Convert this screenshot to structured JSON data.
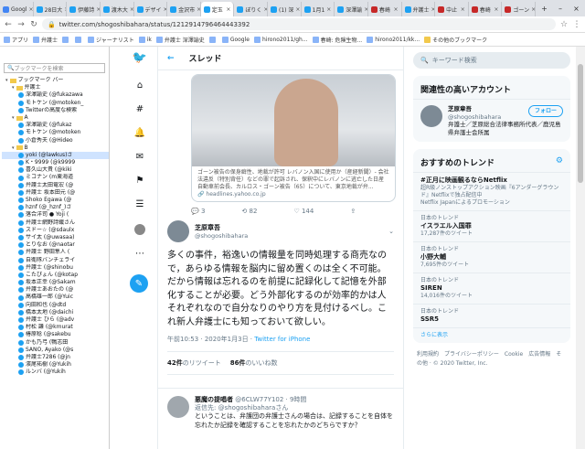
{
  "tabs": [
    {
      "label": "Googl",
      "color": "#4285f4"
    },
    {
      "label": "28日大",
      "color": "#1da1f2"
    },
    {
      "label": "伊藤詩",
      "color": "#1da1f2"
    },
    {
      "label": "渡木大",
      "color": "#1da1f2"
    },
    {
      "label": "デザイ",
      "color": "#1da1f2"
    },
    {
      "label": "金沢市",
      "color": "#1da1f2"
    },
    {
      "label": "定玉",
      "color": "#1da1f2",
      "active": true
    },
    {
      "label": "ぼりく",
      "color": "#1da1f2"
    },
    {
      "label": "(1) 深",
      "color": "#1da1f2"
    },
    {
      "label": "1月1",
      "color": "#1da1f2"
    },
    {
      "label": "深澤諭",
      "color": "#1da1f2"
    },
    {
      "label": "春崎",
      "color": "#c62828"
    },
    {
      "label": "弁護士",
      "color": "#1da1f2"
    },
    {
      "label": "中止",
      "color": "#c62828"
    },
    {
      "label": "春崎",
      "color": "#c62828"
    },
    {
      "label": "ゴーン",
      "color": "#c62828"
    }
  ],
  "address": {
    "url": "twitter.com/shogoshibahara/status/1212914796464443392"
  },
  "bookmarks": [
    {
      "label": "アプリ",
      "folder": false
    },
    {
      "label": "弁護士",
      "folder": false
    },
    {
      "label": "",
      "folder": false
    },
    {
      "label": "",
      "folder": false
    },
    {
      "label": "ジャーナリスト",
      "folder": false
    },
    {
      "label": "ik",
      "folder": false
    },
    {
      "label": "弁護士 深澤諭史",
      "folder": false
    },
    {
      "label": "",
      "folder": false
    },
    {
      "label": "Google",
      "folder": false
    },
    {
      "label": "hirono2011/gh...",
      "folder": false
    },
    {
      "label": "春崎: 危険生物...",
      "folder": false
    },
    {
      "label": "hirono2011/kk...",
      "folder": false
    },
    {
      "label": "その他のブックマーク",
      "folder": true
    }
  ],
  "sidebar": {
    "search_placeholder": "ブックマークを検索",
    "items": [
      {
        "label": "ブックマーク バー",
        "type": "folder",
        "level": 0
      },
      {
        "label": "弁護士",
        "type": "folder",
        "level": 1
      },
      {
        "label": "深澤諭史 (@fukazawa",
        "type": "bird",
        "level": 2
      },
      {
        "label": "モトケン (@motoken_",
        "type": "bird",
        "level": 2
      },
      {
        "label": "Twitterの高度な検索",
        "type": "bird",
        "level": 2
      },
      {
        "label": "A",
        "type": "folder",
        "level": 1
      },
      {
        "label": "深澤諭史 (@fukaz",
        "type": "bird",
        "level": 2
      },
      {
        "label": "モトケン (@motoken",
        "type": "bird",
        "level": 2
      },
      {
        "label": "小倉秀夫 (@Hideo",
        "type": "bird",
        "level": 2
      },
      {
        "label": "B",
        "type": "folder",
        "level": 1
      },
      {
        "label": "yoki (@lawkus)さ",
        "type": "bird",
        "level": 2,
        "hl": true
      },
      {
        "label": "K・9999 (@k9999",
        "type": "bird",
        "level": 2
      },
      {
        "label": "喜久山大貴 (@kiki",
        "type": "bird",
        "level": 2
      },
      {
        "label": "ミコナン (m東海道",
        "type": "bird",
        "level": 2
      },
      {
        "label": "弁護士太田竜宏 (@",
        "type": "bird",
        "level": 2
      },
      {
        "label": "弁護士 坂本田元 (@",
        "type": "bird",
        "level": 2
      },
      {
        "label": "Shoko Egawa (@",
        "type": "bird",
        "level": 2
      },
      {
        "label": "hznf (@_hznf_)さ",
        "type": "bird",
        "level": 2
      },
      {
        "label": "落合洋司 ● Yoji (",
        "type": "bird",
        "level": 2
      },
      {
        "label": "弁護士網野詩織さん",
        "type": "bird",
        "level": 2
      },
      {
        "label": "スドー☆ (@sdaulx",
        "type": "bird",
        "level": 2
      },
      {
        "label": "サイ太 (@uwasaa)",
        "type": "bird",
        "level": 2
      },
      {
        "label": "とりなお (@naotar",
        "type": "bird",
        "level": 2
      },
      {
        "label": "弁護士 野田隼人 (",
        "type": "bird",
        "level": 2
      },
      {
        "label": "自衛隊バンチェライ",
        "type": "bird",
        "level": 2
      },
      {
        "label": "弁護士 (@shinobu",
        "type": "bird",
        "level": 2
      },
      {
        "label": "こたぴょん (@kotap",
        "type": "bird",
        "level": 2
      },
      {
        "label": "坂本正幸 (@Sakam",
        "type": "bird",
        "level": 2
      },
      {
        "label": "弁護士あおたの (@",
        "type": "bird",
        "level": 2
      },
      {
        "label": "高橋雄一郎 (@Yuic",
        "type": "bird",
        "level": 2
      },
      {
        "label": "向田和也 (@dtd",
        "type": "bird",
        "level": 2
      },
      {
        "label": "橋本太地 (@daichi",
        "type": "bird",
        "level": 2
      },
      {
        "label": "弁護士 ひら (@adv",
        "type": "bird",
        "level": 2
      },
      {
        "label": "村松 謙 (@kmurat",
        "type": "bird",
        "level": 2
      },
      {
        "label": "椿原稔 (@sakebu",
        "type": "bird",
        "level": 2
      },
      {
        "label": "かも乃弓 (鴨志田",
        "type": "bird",
        "level": 2
      },
      {
        "label": "SANO, Ayako (@s",
        "type": "bird",
        "level": 2
      },
      {
        "label": "弁護士7286 (@jn",
        "type": "bird",
        "level": 2
      },
      {
        "label": "濱尾祐樹 (@Yukih",
        "type": "bird",
        "level": 2
      },
      {
        "label": "ルンバ (@Yukih",
        "type": "bird",
        "level": 2
      }
    ]
  },
  "header": {
    "title": "スレッド",
    "back_icon": "arrow-left-icon"
  },
  "card": {
    "text": "ゴーン被告の保身癖性、地裁が許可 レバノン入国に使用か（産経新聞）- 会社法違反（特別背任）などの罪で起訴され、保釈中にレバノンに逃亡した日産自動車前会長、カルロス・ゴーン被告（65）について、東京地裁が弁...",
    "link": "headlines.yahoo.co.jp"
  },
  "actions": {
    "replies": "3",
    "retweets": "82",
    "likes": "144"
  },
  "tweet": {
    "name": "芝原章吾",
    "handle": "@shogoshibahara",
    "body": "多くの事件，裕逸いの情報量を同時処理する商売なので，あらゆる情報を脳内に留め置くのは全く不可能。だから情報は忘れるのを前提に記録化して記憶を外部化することが必要。どう外部化するのが効率的かは人それぞれなので自分なりのやり方を見付けるべし。これ新人弁護士にも知っておいて欲しい。",
    "time": "午前10:53 · 2020年1月3日 · ",
    "client": "Twitter for iPhone",
    "retweets": "42件",
    "retweets_label": "のリツイート",
    "likes": "86件",
    "likes_label": "のいいね数"
  },
  "reply": {
    "name": "悪魔の提唱者",
    "handle": "@6CLW77Y102 · 9時間",
    "to": "返信先: @shogoshibaharaさん",
    "body": "ということは、弁護団の弁護士さんの場合は、記録することを自体を忘れたか記録を確認することを忘れたかのどちらですか？"
  },
  "right": {
    "search_placeholder": "キーワード検索",
    "related_title": "関連性の高いアカウント",
    "account": {
      "name": "芝原章吾",
      "handle": "@shogoshibahara",
      "bio": "弁護士／芝原総合法律事務所代表／鹿児島県弁護士会所属",
      "follow": "フォロー"
    },
    "trends_title": "おすすめのトレンド",
    "trends": [
      {
        "cat": "",
        "name": "#正月に映画観るならNetflix",
        "meta": "超R級ノンストップアクション映画『6アンダーグラウンド』Netflixで独占配信中",
        "promo": "Netflix Japanによるプロモーション"
      },
      {
        "cat": "日本のトレンド",
        "name": "イスラエル入国罪",
        "meta": "17,287件のツイート"
      },
      {
        "cat": "日本のトレンド",
        "name": "小野大輔",
        "meta": "7,695件のツイート"
      },
      {
        "cat": "日本のトレンド",
        "name": "SIREN",
        "meta": "14,016件のツイート"
      },
      {
        "cat": "日本のトレンド",
        "name": "SSR5",
        "meta": ""
      }
    ],
    "more": "さらに表示",
    "footer": "利用規約　プライバシーポリシー　Cookie　広告情報　その他 · © 2020 Twitter, Inc."
  }
}
